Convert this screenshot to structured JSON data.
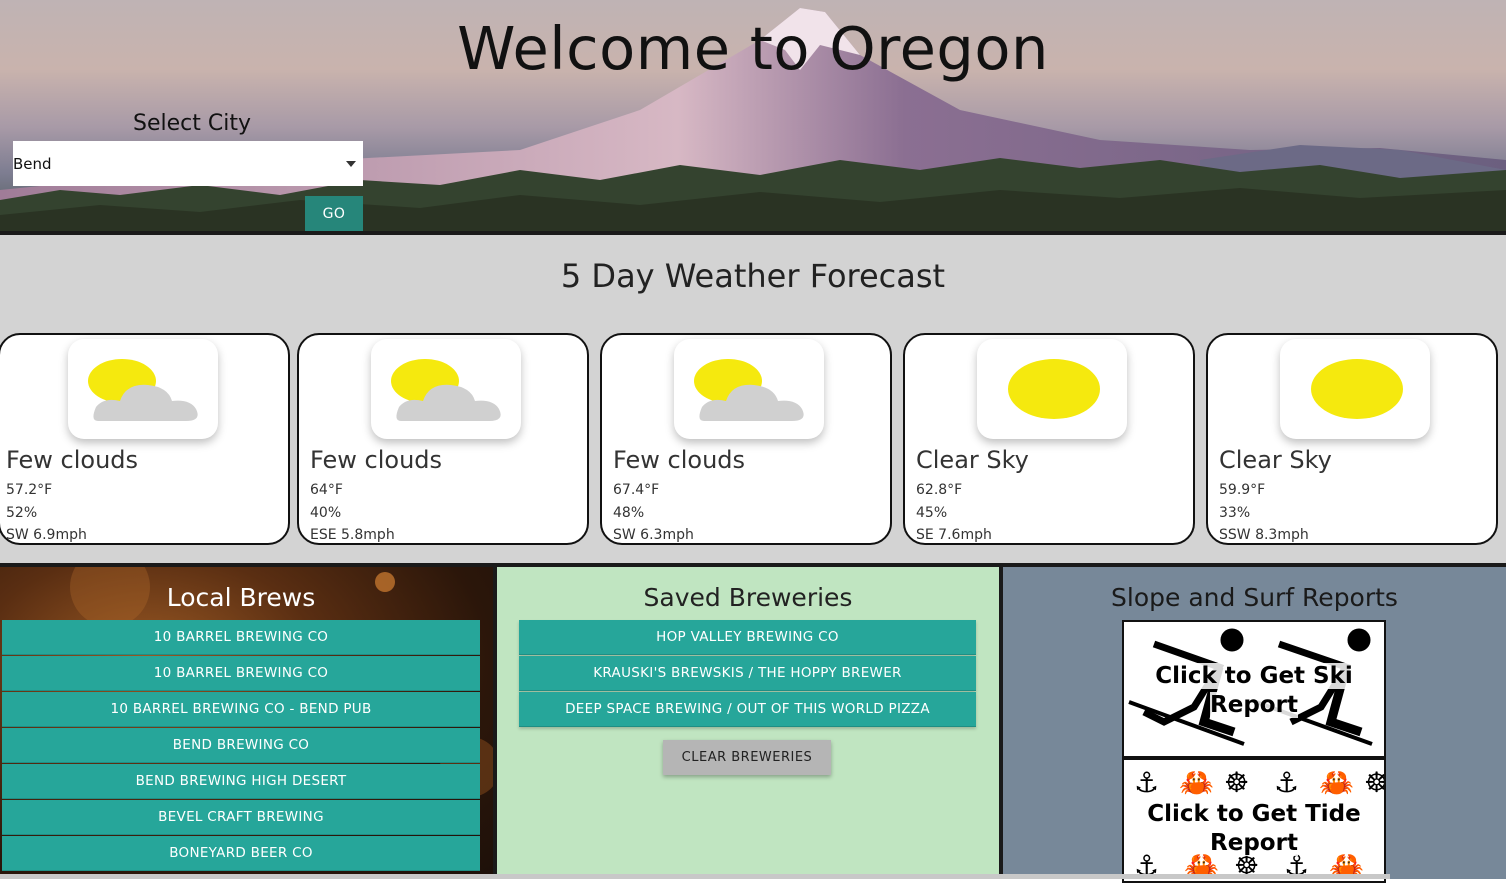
{
  "header": {
    "title": "Welcome to Oregon",
    "select_label": "Select City",
    "selected_city": "Bend",
    "go_label": "GO"
  },
  "forecast": {
    "title": "5 Day Weather Forecast",
    "days": [
      {
        "icon": "partly-cloudy-icon",
        "description": "Few clouds",
        "temp": "57.2°F",
        "humidity": "52%",
        "wind": "SW 6.9mph"
      },
      {
        "icon": "partly-cloudy-icon",
        "description": "Few clouds",
        "temp": "64°F",
        "humidity": "40%",
        "wind": "ESE 5.8mph"
      },
      {
        "icon": "partly-cloudy-icon",
        "description": "Few clouds",
        "temp": "67.4°F",
        "humidity": "48%",
        "wind": "SW 6.3mph"
      },
      {
        "icon": "sun-icon",
        "description": "Clear Sky",
        "temp": "62.8°F",
        "humidity": "45%",
        "wind": "SE 7.6mph"
      },
      {
        "icon": "sun-icon",
        "description": "Clear Sky",
        "temp": "59.9°F",
        "humidity": "33%",
        "wind": "SSW 8.3mph"
      }
    ]
  },
  "local_brews": {
    "title": "Local Brews",
    "items": [
      "10 BARREL BREWING CO",
      "10 BARREL BREWING CO",
      "10 BARREL BREWING CO - BEND PUB",
      "BEND BREWING CO",
      "BEND BREWING HIGH DESERT",
      "BEVEL CRAFT BREWING",
      "BONEYARD BEER CO"
    ]
  },
  "saved_breweries": {
    "title": "Saved Breweries",
    "items": [
      "HOP VALLEY BREWING CO",
      "KRAUSKI'S BREWSKIS / THE HOPPY BREWER",
      "DEEP SPACE BREWING / OUT OF THIS WORLD PIZZA"
    ],
    "clear_label": "CLEAR BREWERIES"
  },
  "reports": {
    "title": "Slope and Surf Reports",
    "ski_label": "Click to Get Ski Report",
    "tide_label": "Click to Get Tide Report"
  },
  "colors": {
    "teal": "#26a69a",
    "go_button": "#26867a",
    "forecast_bg": "#d3d3d3",
    "saved_bg": "#c0e5c1",
    "reports_bg": "#778899",
    "sun": "#f5e90e",
    "cloud": "#d0d0d0"
  }
}
